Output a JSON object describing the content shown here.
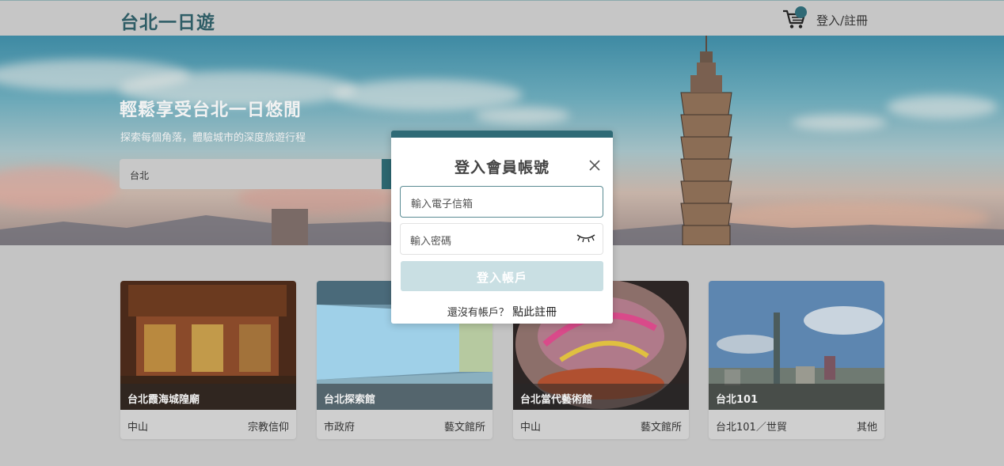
{
  "header": {
    "logo": "台北一日遊",
    "login_label": "登入/註冊",
    "cart_icon": "cart-icon"
  },
  "hero": {
    "title": "輕鬆享受台北一日悠閒",
    "subtitle": "探索每個角落，體驗城市的深度旅遊行程",
    "search_value": "台北"
  },
  "cards": [
    {
      "name": "台北霞海城隍廟",
      "mrt": "中山",
      "category": "宗教信仰"
    },
    {
      "name": "台北探索館",
      "mrt": "市政府",
      "category": "藝文館所"
    },
    {
      "name": "台北當代藝術館",
      "mrt": "中山",
      "category": "藝文館所"
    },
    {
      "name": "台北101",
      "mrt": "台北101／世貿",
      "category": "其他"
    }
  ],
  "modal": {
    "title": "登入會員帳號",
    "email_placeholder": "輸入電子信箱",
    "password_placeholder": "輸入密碼",
    "submit_label": "登入帳戶",
    "register_prefix": "還沒有帳戶？",
    "register_link": "點此註冊"
  },
  "colors": {
    "accent": "#2f6a76",
    "submit_bg": "#c9dfe3"
  }
}
